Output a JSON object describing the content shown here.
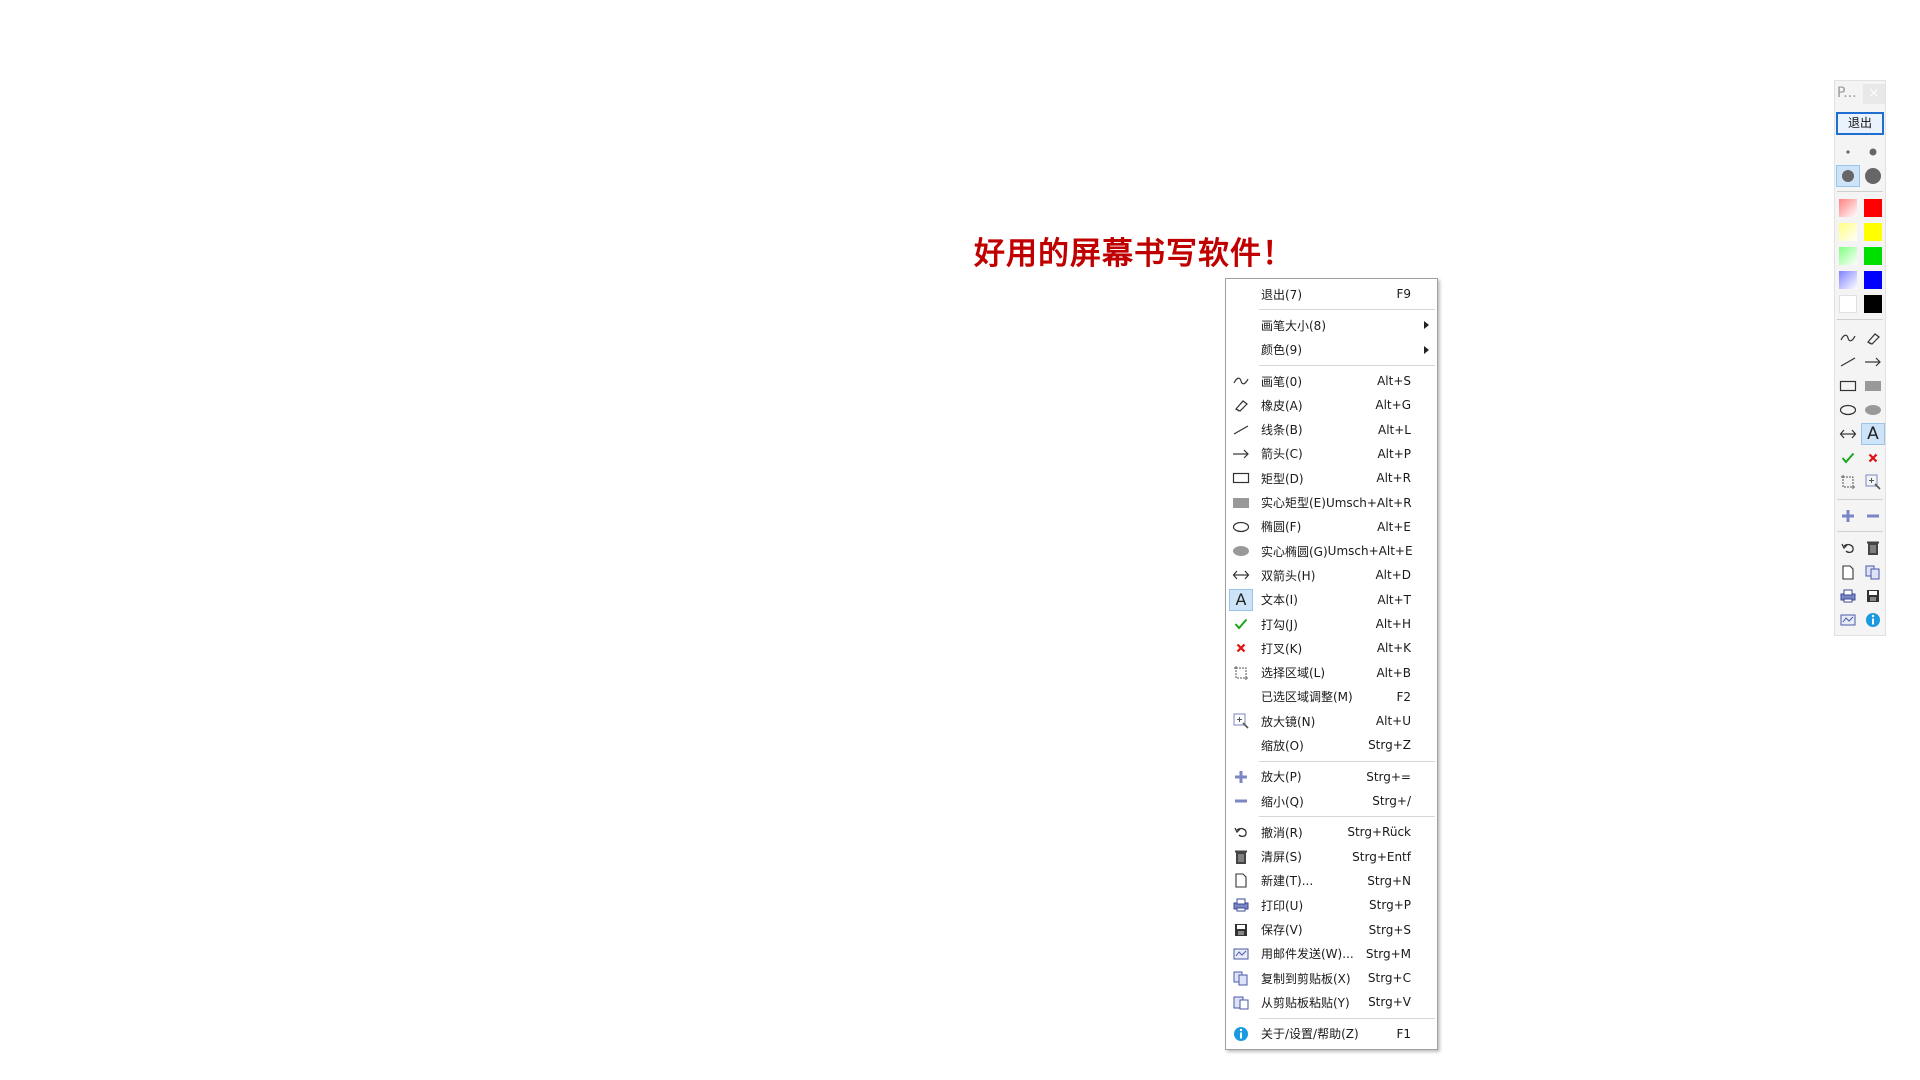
{
  "canvas": {
    "text": "好用的屏幕书写软件！",
    "text_color": "#c00000"
  },
  "toolbar": {
    "title": "P...",
    "close": "×",
    "exit_label": "退出",
    "colors": [
      "#ff8080",
      "#ff0000",
      "#ffff80",
      "#ffff00",
      "#80ff80",
      "#00e000",
      "#8080ff",
      "#0000ff",
      "#ffffff",
      "#000000"
    ]
  },
  "menu": {
    "items": [
      {
        "label": "退出(7)",
        "shortcut": "F9",
        "icon": ""
      },
      {
        "sep": true
      },
      {
        "label": "画笔大小(8)",
        "shortcut": "",
        "icon": "",
        "submenu": true
      },
      {
        "label": "颜色(9)",
        "shortcut": "",
        "icon": "",
        "submenu": true
      },
      {
        "sep": true
      },
      {
        "label": "画笔(0)",
        "shortcut": "Alt+S",
        "icon": "pen-icon"
      },
      {
        "label": "橡皮(A)",
        "shortcut": "Alt+G",
        "icon": "eraser-icon"
      },
      {
        "label": "线条(B)",
        "shortcut": "Alt+L",
        "icon": "line-icon"
      },
      {
        "label": "箭头(C)",
        "shortcut": "Alt+P",
        "icon": "arrow-icon"
      },
      {
        "label": "矩型(D)",
        "shortcut": "Alt+R",
        "icon": "rect-icon"
      },
      {
        "label": "实心矩型(E)",
        "shortcut": "Umsch+Alt+R",
        "icon": "filled-rect-icon"
      },
      {
        "label": "椭圆(F)",
        "shortcut": "Alt+E",
        "icon": "ellipse-icon"
      },
      {
        "label": "实心椭圆(G)",
        "shortcut": "Umsch+Alt+E",
        "icon": "filled-ellipse-icon"
      },
      {
        "label": "双箭头(H)",
        "shortcut": "Alt+D",
        "icon": "double-arrow-icon"
      },
      {
        "label": "文本(I)",
        "shortcut": "Alt+T",
        "icon": "text-icon",
        "selected": true
      },
      {
        "label": "打勾(J)",
        "shortcut": "Alt+H",
        "icon": "check-icon"
      },
      {
        "label": "打叉(K)",
        "shortcut": "Alt+K",
        "icon": "cross-icon"
      },
      {
        "label": "选择区域(L)",
        "shortcut": "Alt+B",
        "icon": "select-area-icon"
      },
      {
        "label": "已选区域调整(M)",
        "shortcut": "F2",
        "icon": ""
      },
      {
        "label": "放大镜(N)",
        "shortcut": "Alt+U",
        "icon": "magnifier-icon"
      },
      {
        "label": "缩放(O)",
        "shortcut": "Strg+Z",
        "icon": ""
      },
      {
        "sep": true
      },
      {
        "label": "放大(P)",
        "shortcut": "Strg+=",
        "icon": "plus-icon"
      },
      {
        "label": "缩小(Q)",
        "shortcut": "Strg+/",
        "icon": "minus-icon"
      },
      {
        "sep": true
      },
      {
        "label": "撤消(R)",
        "shortcut": "Strg+Rück",
        "icon": "undo-icon"
      },
      {
        "label": "清屏(S)",
        "shortcut": "Strg+Entf",
        "icon": "trash-icon"
      },
      {
        "label": "新建(T)...",
        "shortcut": "Strg+N",
        "icon": "new-page-icon"
      },
      {
        "label": "打印(U)",
        "shortcut": "Strg+P",
        "icon": "print-icon"
      },
      {
        "label": "保存(V)",
        "shortcut": "Strg+S",
        "icon": "save-icon"
      },
      {
        "label": "用邮件发送(W)...",
        "shortcut": "Strg+M",
        "icon": "mail-icon"
      },
      {
        "label": "复制到剪贴板(X)",
        "shortcut": "Strg+C",
        "icon": "copy-icon"
      },
      {
        "label": "从剪贴板粘贴(Y)",
        "shortcut": "Strg+V",
        "icon": "paste-icon"
      },
      {
        "sep": true
      },
      {
        "label": "关于/设置/帮助(Z)",
        "shortcut": "F1",
        "icon": "info-icon"
      }
    ]
  }
}
